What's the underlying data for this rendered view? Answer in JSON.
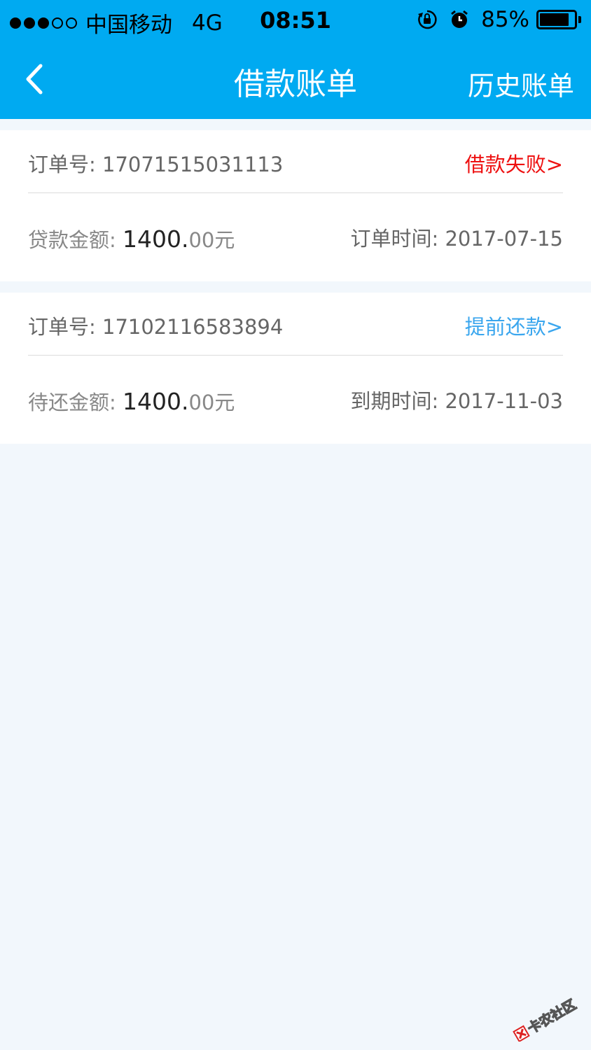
{
  "status_bar": {
    "carrier": "中国移动",
    "network": "4G",
    "time": "08:51",
    "battery": "85%",
    "battery_level": 0.85
  },
  "nav": {
    "title": "借款账单",
    "right_label": "历史账单"
  },
  "bills": [
    {
      "order_label": "订单号:",
      "order_no": "17071515031113",
      "action": "借款失败>",
      "action_color": "#ee1111",
      "amount_label": "贷款金额:",
      "amount_int": "1400.",
      "amount_dec": "00元",
      "date_label": "订单时间:",
      "date": "2017-07-15"
    },
    {
      "order_label": "订单号:",
      "order_no": "17102116583894",
      "action": "提前还款>",
      "action_color": "#3aa6ee",
      "amount_label": "待还金额:",
      "amount_int": "1400.",
      "amount_dec": "00元",
      "date_label": "到期时间:",
      "date": "2017-11-03"
    }
  ],
  "watermark": {
    "text": "卡农社区"
  },
  "colors": {
    "header": "#00aaf1",
    "background": "#f2f7fc"
  }
}
